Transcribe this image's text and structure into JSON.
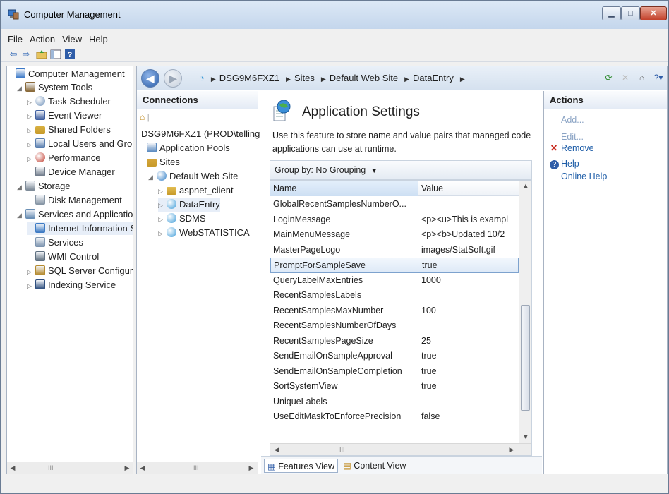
{
  "window": {
    "title": "Computer Management"
  },
  "menu": [
    "File",
    "Action",
    "View",
    "Help"
  ],
  "tree": {
    "items": [
      {
        "label": "Computer Management",
        "indent": 0,
        "arrow": "",
        "icon": "computer-management-icon"
      },
      {
        "label": "System Tools",
        "indent": 1,
        "arrow": "◢",
        "icon": "system-tools-icon"
      },
      {
        "label": "Task Scheduler",
        "indent": 2,
        "arrow": "▷",
        "icon": "clock-icon"
      },
      {
        "label": "Event Viewer",
        "indent": 2,
        "arrow": "▷",
        "icon": "event-viewer-icon"
      },
      {
        "label": "Shared Folders",
        "indent": 2,
        "arrow": "▷",
        "icon": "shared-folder-icon"
      },
      {
        "label": "Local Users and Groups",
        "indent": 2,
        "arrow": "▷",
        "icon": "users-icon"
      },
      {
        "label": "Performance",
        "indent": 2,
        "arrow": "▷",
        "icon": "performance-icon"
      },
      {
        "label": "Device Manager",
        "indent": 2,
        "arrow": "",
        "icon": "device-manager-icon"
      },
      {
        "label": "Storage",
        "indent": 1,
        "arrow": "◢",
        "icon": "storage-icon"
      },
      {
        "label": "Disk Management",
        "indent": 2,
        "arrow": "",
        "icon": "disk-icon"
      },
      {
        "label": "Services and Applications",
        "indent": 1,
        "arrow": "◢",
        "icon": "services-apps-icon"
      },
      {
        "label": "Internet Information Services",
        "indent": 2,
        "arrow": "",
        "icon": "iis-icon",
        "selected": true
      },
      {
        "label": "Services",
        "indent": 2,
        "arrow": "",
        "icon": "services-icon"
      },
      {
        "label": "WMI Control",
        "indent": 2,
        "arrow": "",
        "icon": "wmi-icon"
      },
      {
        "label": "SQL Server Configuration Manager",
        "indent": 2,
        "arrow": "▷",
        "icon": "sql-server-icon"
      },
      {
        "label": "Indexing Service",
        "indent": 2,
        "arrow": "▷",
        "icon": "indexing-icon"
      }
    ]
  },
  "breadcrumb": [
    "DSG9M6FXZ1",
    "Sites",
    "Default Web Site",
    "DataEntry"
  ],
  "connections": {
    "heading": "Connections",
    "items": [
      {
        "label": "DSG9M6FXZ1 (PROD\\telling",
        "indent": 0,
        "arrow": "",
        "icon": "server-icon"
      },
      {
        "label": "Application Pools",
        "indent": 0,
        "arrow": "",
        "icon": "app-pool-icon"
      },
      {
        "label": "Sites",
        "indent": 0,
        "arrow": "",
        "icon": "sites-icon"
      },
      {
        "label": "Default Web Site",
        "indent": 1,
        "arrow": "◢",
        "icon": "globe-icon"
      },
      {
        "label": "aspnet_client",
        "indent": 2,
        "arrow": "▷",
        "icon": "folder-icon"
      },
      {
        "label": "DataEntry",
        "indent": 2,
        "arrow": "▷",
        "icon": "web-app-icon",
        "selected": true
      },
      {
        "label": "SDMS",
        "indent": 2,
        "arrow": "▷",
        "icon": "web-app-icon"
      },
      {
        "label": "WebSTATISTICA",
        "indent": 2,
        "arrow": "▷",
        "icon": "web-app-icon"
      }
    ]
  },
  "feature": {
    "title": "Application Settings",
    "description": "Use this feature to store name and value pairs that managed code applications can use at runtime.",
    "group_by_label": "Group by:",
    "group_by_value": "No Grouping",
    "columns": [
      "Name",
      "Value"
    ],
    "rows": [
      {
        "name": "GlobalRecentSamplesNumberO...",
        "value": ""
      },
      {
        "name": "LoginMessage",
        "value": "<p><u>This is exampl"
      },
      {
        "name": "MainMenuMessage",
        "value": "<p><b>Updated 10/2"
      },
      {
        "name": "MasterPageLogo",
        "value": "images/StatSoft.gif"
      },
      {
        "name": "PromptForSampleSave",
        "value": "true",
        "selected": true
      },
      {
        "name": "QueryLabelMaxEntries",
        "value": "1000"
      },
      {
        "name": "RecentSamplesLabels",
        "value": ""
      },
      {
        "name": "RecentSamplesMaxNumber",
        "value": "100"
      },
      {
        "name": "RecentSamplesNumberOfDays",
        "value": ""
      },
      {
        "name": "RecentSamplesPageSize",
        "value": "25"
      },
      {
        "name": "SendEmailOnSampleApproval",
        "value": "true"
      },
      {
        "name": "SendEmailOnSampleCompletion",
        "value": "true"
      },
      {
        "name": "SortSystemView",
        "value": "true"
      },
      {
        "name": "UniqueLabels",
        "value": ""
      },
      {
        "name": "UseEditMaskToEnforcePrecision",
        "value": "false"
      }
    ],
    "tabs": [
      "Features View",
      "Content View"
    ]
  },
  "actions": {
    "heading": "Actions",
    "items": [
      {
        "label": "Add...",
        "style": "dis"
      },
      {
        "label": "Edit...",
        "style": "dis"
      },
      {
        "label": "Remove",
        "style": "link",
        "icon": "remove-icon"
      },
      {
        "label": "Help",
        "style": "link",
        "icon": "help-icon"
      },
      {
        "label": "Online Help",
        "style": "link"
      }
    ]
  },
  "colors": {
    "accent": "#1f5ea8",
    "selection": "#cde3f8",
    "remove": "#c8281c"
  }
}
